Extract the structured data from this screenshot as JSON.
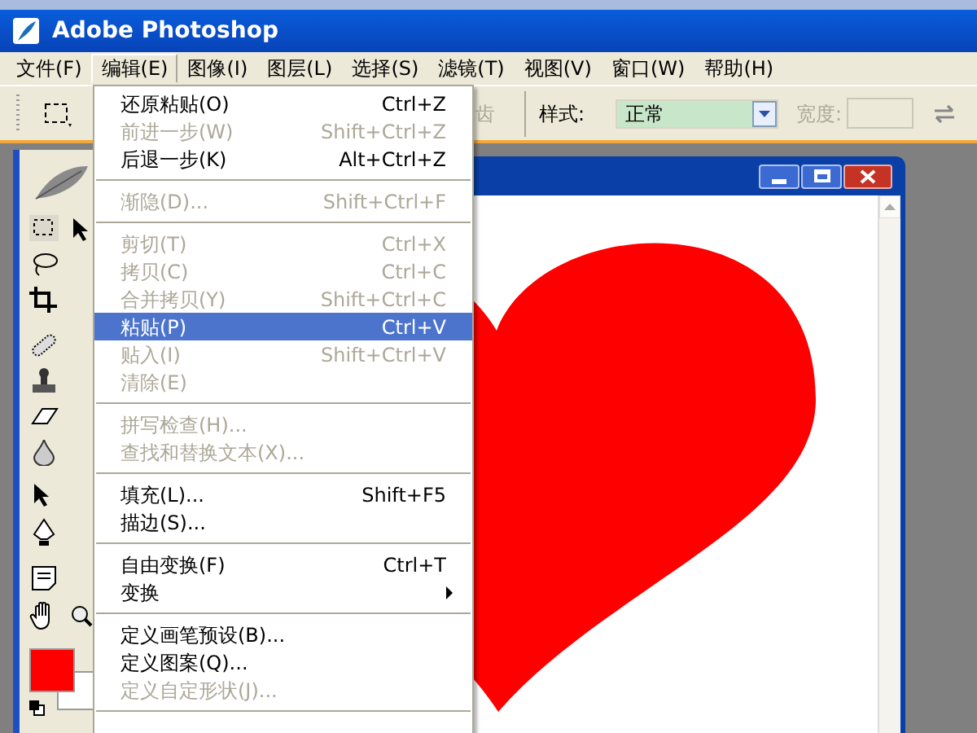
{
  "window": {
    "title": "Adobe Photoshop"
  },
  "menu_bar": [
    {
      "label": "文件(F)",
      "selected": false
    },
    {
      "label": "编辑(E)",
      "selected": true
    },
    {
      "label": "图像(I)",
      "selected": false
    },
    {
      "label": "图层(L)",
      "selected": false
    },
    {
      "label": "选择(S)",
      "selected": false
    },
    {
      "label": "滤镜(T)",
      "selected": false
    },
    {
      "label": "视图(V)",
      "selected": false
    },
    {
      "label": "窗口(W)",
      "selected": false
    },
    {
      "label": "帮助(H)",
      "selected": false
    }
  ],
  "options_bar": {
    "antialias_label": "齿",
    "style_label": "样式:",
    "style_value": "正常",
    "width_label": "宽度:"
  },
  "edit_menu": {
    "items": [
      {
        "kind": "item",
        "label": "还原粘贴(O)",
        "shortcut": "Ctrl+Z",
        "disabled": false,
        "selected": false
      },
      {
        "kind": "item",
        "label": "前进一步(W)",
        "shortcut": "Shift+Ctrl+Z",
        "disabled": true,
        "selected": false
      },
      {
        "kind": "item",
        "label": "后退一步(K)",
        "shortcut": "Alt+Ctrl+Z",
        "disabled": false,
        "selected": false
      },
      {
        "kind": "separator"
      },
      {
        "kind": "item",
        "label": "渐隐(D)...",
        "shortcut": "Shift+Ctrl+F",
        "disabled": true,
        "selected": false
      },
      {
        "kind": "separator"
      },
      {
        "kind": "item",
        "label": "剪切(T)",
        "shortcut": "Ctrl+X",
        "disabled": true,
        "selected": false
      },
      {
        "kind": "item",
        "label": "拷贝(C)",
        "shortcut": "Ctrl+C",
        "disabled": true,
        "selected": false
      },
      {
        "kind": "item",
        "label": "合并拷贝(Y)",
        "shortcut": "Shift+Ctrl+C",
        "disabled": true,
        "selected": false
      },
      {
        "kind": "item",
        "label": "粘贴(P)",
        "shortcut": "Ctrl+V",
        "disabled": false,
        "selected": true
      },
      {
        "kind": "item",
        "label": "贴入(I)",
        "shortcut": "Shift+Ctrl+V",
        "disabled": true,
        "selected": false
      },
      {
        "kind": "item",
        "label": "清除(E)",
        "disabled": true,
        "selected": false
      },
      {
        "kind": "separator"
      },
      {
        "kind": "item",
        "label": "拼写检查(H)...",
        "disabled": true,
        "selected": false
      },
      {
        "kind": "item",
        "label": "查找和替换文本(X)...",
        "disabled": true,
        "selected": false
      },
      {
        "kind": "separator"
      },
      {
        "kind": "item",
        "label": "填充(L)...",
        "shortcut": "Shift+F5",
        "disabled": false,
        "selected": false
      },
      {
        "kind": "item",
        "label": "描边(S)...",
        "disabled": false,
        "selected": false
      },
      {
        "kind": "separator"
      },
      {
        "kind": "item",
        "label": "自由变换(F)",
        "shortcut": "Ctrl+T",
        "disabled": false,
        "selected": false
      },
      {
        "kind": "submenu",
        "label": "变换",
        "disabled": false,
        "selected": false
      },
      {
        "kind": "separator"
      },
      {
        "kind": "item",
        "label": "定义画笔预设(B)...",
        "disabled": false,
        "selected": false
      },
      {
        "kind": "item",
        "label": "定义图案(Q)...",
        "disabled": false,
        "selected": false
      },
      {
        "kind": "item",
        "label": "定义自定形状(J)...",
        "disabled": true,
        "selected": false
      },
      {
        "kind": "separator"
      }
    ]
  }
}
